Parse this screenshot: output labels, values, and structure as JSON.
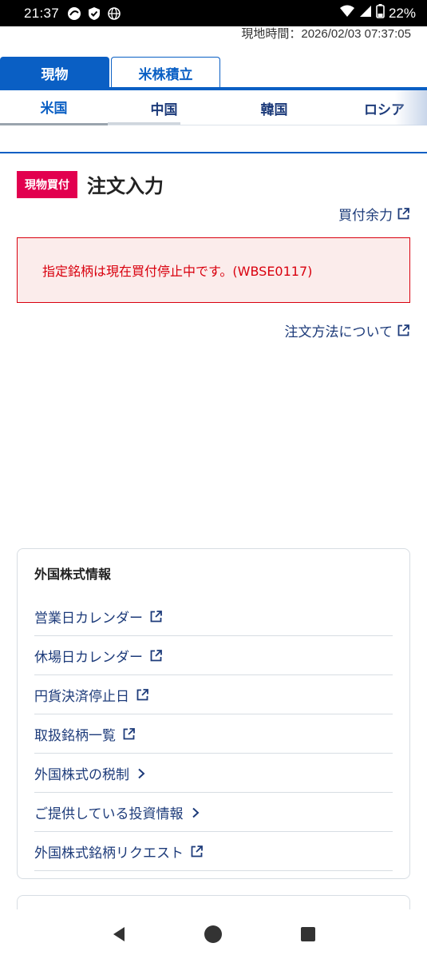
{
  "status_bar": {
    "time": "21:37",
    "battery": "22%",
    "icons": [
      "location-icon",
      "shield-icon",
      "globe-icon"
    ]
  },
  "local_time": "現地時間：2026/02/03 07:37:05",
  "top_tabs": [
    {
      "label": "現物",
      "active": true
    },
    {
      "label": "米株積立",
      "active": false
    }
  ],
  "market_tabs": [
    {
      "label": "米国",
      "active": true
    },
    {
      "label": "中国",
      "active": false
    },
    {
      "label": "韓国",
      "active": false
    },
    {
      "label": "ロシア",
      "active": false
    }
  ],
  "order": {
    "badge": "現物買付",
    "title": "注文入力",
    "buying_power_link": "買付余力",
    "error_message": "指定銘柄は現在買付停止中です。(WBSE0117)",
    "order_method_link": "注文方法について"
  },
  "info": {
    "title": "外国株式情報",
    "items": [
      {
        "label": "営業日カレンダー",
        "icon": "external-link-icon"
      },
      {
        "label": "休場日カレンダー",
        "icon": "external-link-icon"
      },
      {
        "label": "円貨決済停止日",
        "icon": "external-link-icon"
      },
      {
        "label": "取扱銘柄一覧",
        "icon": "external-link-icon"
      },
      {
        "label": "外国株式の税制",
        "icon": "chevron-right-icon"
      },
      {
        "label": "ご提供している投資情報",
        "icon": "chevron-right-icon"
      },
      {
        "label": "外国株式銘柄リクエスト",
        "icon": "external-link-icon"
      }
    ]
  },
  "colors": {
    "primary": "#0a5fc4",
    "link": "#1d3b7a",
    "badge": "#e2004f",
    "error": "#d9000e",
    "error_bg": "#fbeceb"
  }
}
